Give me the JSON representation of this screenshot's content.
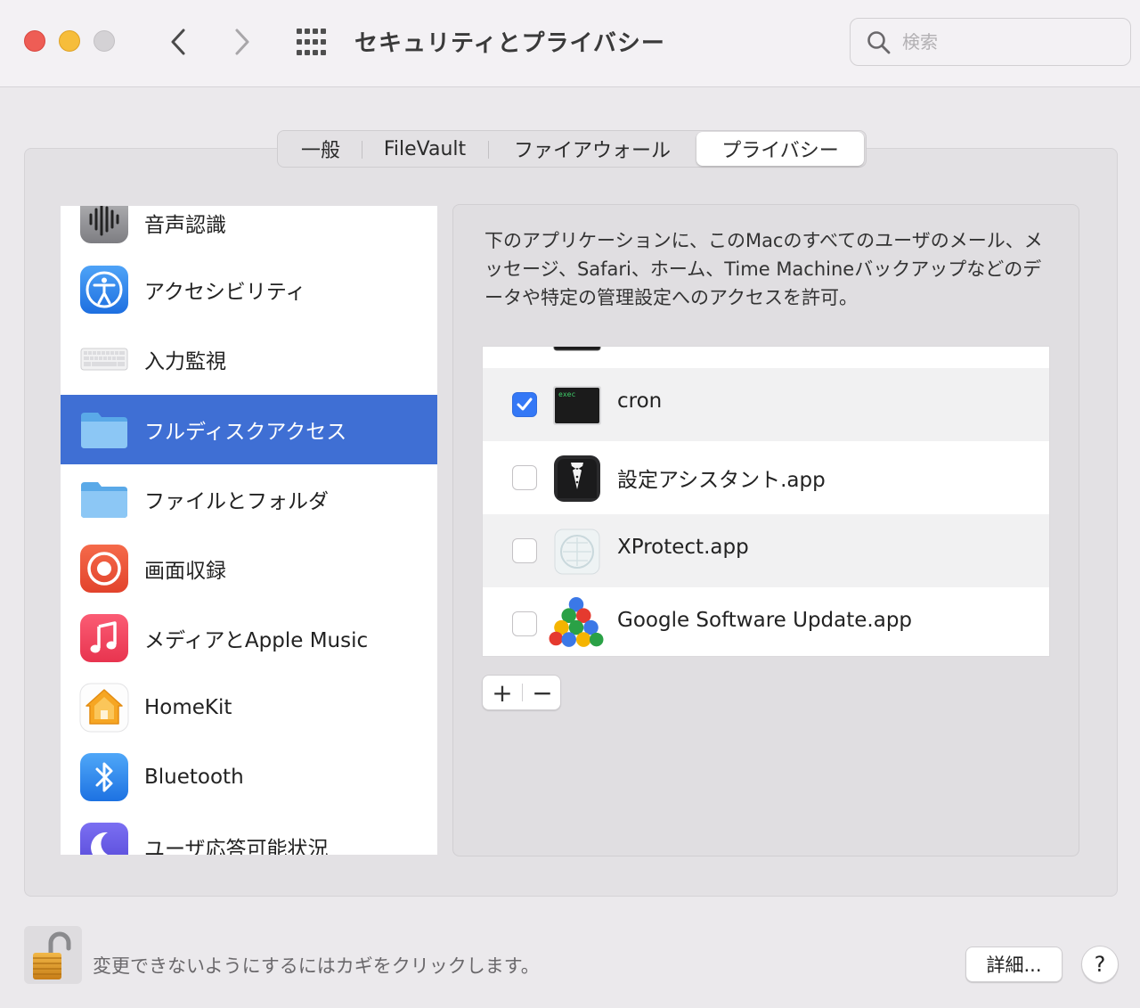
{
  "window": {
    "title": "セキュリティとプライバシー",
    "search_placeholder": "検索"
  },
  "tabs": [
    {
      "label": "一般",
      "active": false
    },
    {
      "label": "FileVault",
      "active": false
    },
    {
      "label": "ファイアウォール",
      "active": false
    },
    {
      "label": "プライバシー",
      "active": true
    }
  ],
  "sidebar": {
    "items": [
      {
        "label": "音声認識",
        "icon": "waveform-icon"
      },
      {
        "label": "アクセシビリティ",
        "icon": "accessibility-icon"
      },
      {
        "label": "入力監視",
        "icon": "keyboard-icon"
      },
      {
        "label": "フルディスクアクセス",
        "icon": "folder-icon",
        "selected": true
      },
      {
        "label": "ファイルとフォルダ",
        "icon": "folder-icon"
      },
      {
        "label": "画面収録",
        "icon": "screen-record-icon"
      },
      {
        "label": "メディアとApple Music",
        "icon": "music-note-icon"
      },
      {
        "label": "HomeKit",
        "icon": "home-icon"
      },
      {
        "label": "Bluetooth",
        "icon": "bluetooth-icon"
      },
      {
        "label": "ユーザ応答可能状況",
        "icon": "moon-icon"
      }
    ]
  },
  "content": {
    "description": "下のアプリケーションに、このMacのすべてのユーザのメール、メッセージ、Safari、ホーム、Time Machineバックアップなどのデータや特定の管理設定へのアクセスを許可。",
    "apps": [
      {
        "name": "cron",
        "checked": true,
        "icon": "terminal-exec-icon",
        "icon_text": "exec"
      },
      {
        "name": "設定アシスタント.app",
        "checked": false,
        "icon": "butler-icon"
      },
      {
        "name": "XProtect.app",
        "checked": false,
        "icon": "xprotect-icon"
      },
      {
        "name": "Google Software Update.app",
        "checked": false,
        "icon": "google-update-balls-icon"
      }
    ],
    "add_label": "+",
    "remove_label": "−"
  },
  "footer": {
    "lock_text": "変更できないようにするにはカギをクリックします。",
    "detail_label": "詳細...",
    "help_label": "?"
  },
  "colors": {
    "selection": "#3f6fd4",
    "checkbox_checked": "#3478f6",
    "close": "#ee5d55",
    "minimize": "#f6bd3b"
  }
}
